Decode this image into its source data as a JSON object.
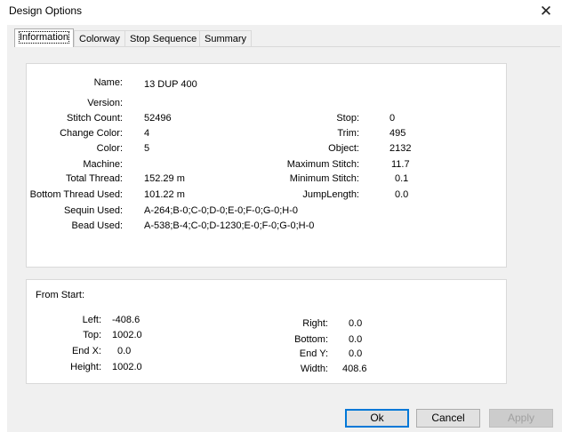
{
  "window": {
    "title": "Design Options",
    "close_glyph": "✕"
  },
  "tabs": [
    {
      "label": "Information"
    },
    {
      "label": "Colorway"
    },
    {
      "label": "Stop Sequence"
    },
    {
      "label": "Summary"
    }
  ],
  "info": {
    "name_label": "Name:",
    "name_value": "13 DUP 400",
    "version_label": "Version:",
    "version_value": "",
    "stitch_count_label": "Stitch Count:",
    "stitch_count_value": "52496",
    "change_color_label": "Change Color:",
    "change_color_value": "4",
    "color_label": "Color:",
    "color_value": "5",
    "machine_label": "Machine:",
    "machine_value": "",
    "total_thread_label": "Total Thread:",
    "total_thread_value": "152.29 m",
    "bottom_thread_label": "Bottom Thread Used:",
    "bottom_thread_value": "101.22 m",
    "sequin_label": "Sequin Used:",
    "sequin_value": "A-264;B-0;C-0;D-0;E-0;F-0;G-0;H-0",
    "bead_label": "Bead Used:",
    "bead_value": "A-538;B-4;C-0;D-1230;E-0;F-0;G-0;H-0",
    "stop_label": "Stop:",
    "stop_value": "0",
    "trim_label": "Trim:",
    "trim_value": "495",
    "object_label": "Object:",
    "object_value": "2132",
    "max_stitch_label": "Maximum Stitch:",
    "max_stitch_value": "11.7",
    "min_stitch_label": "Minimum Stitch:",
    "min_stitch_value": "0.1",
    "jump_length_label": "JumpLength:",
    "jump_length_value": "0.0"
  },
  "start": {
    "heading": "From Start:",
    "left_label": "Left:",
    "left_value": "-408.6",
    "top_label": "Top:",
    "top_value": "1002.0",
    "endx_label": "End X:",
    "endx_value": "0.0",
    "height_label": "Height:",
    "height_value": "1002.0",
    "right_label": "Right:",
    "right_value": "0.0",
    "bottom_label": "Bottom:",
    "bottom_value": "0.0",
    "endy_label": "End Y:",
    "endy_value": "0.0",
    "width_label": "Width:",
    "width_value": "408.6"
  },
  "buttons": {
    "ok": "Ok",
    "cancel": "Cancel",
    "apply": "Apply"
  }
}
